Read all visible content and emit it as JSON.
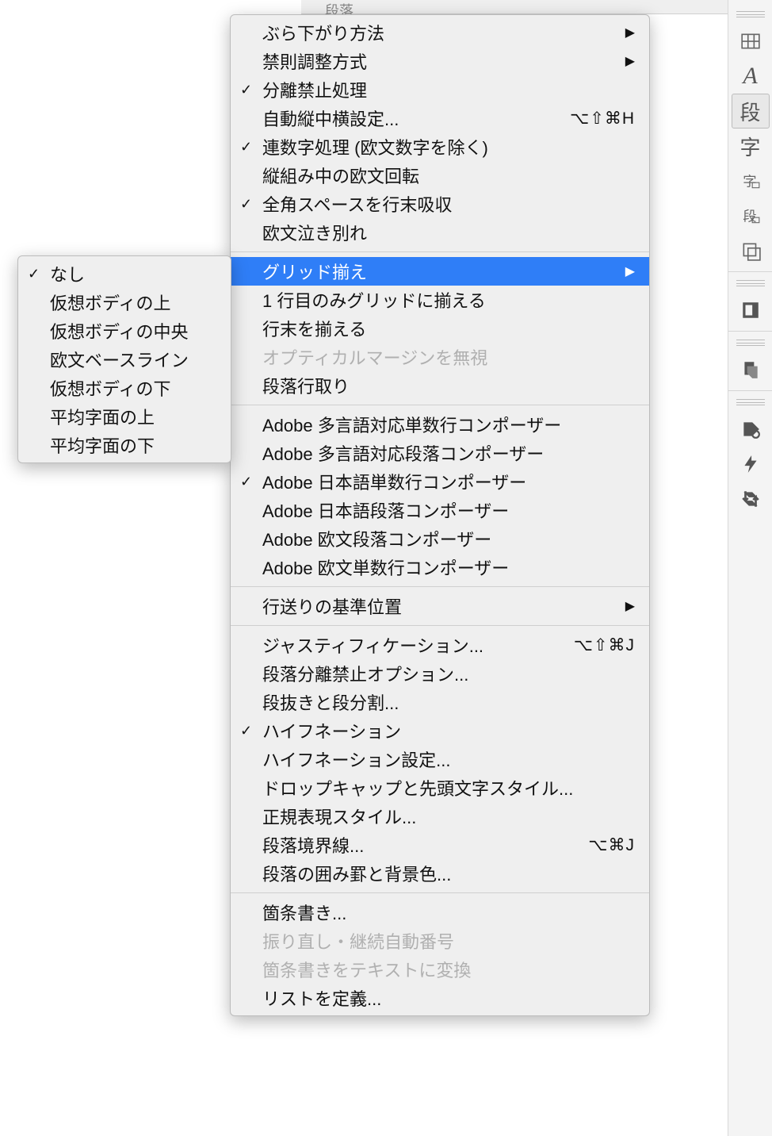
{
  "toolbar": {
    "text": "段落"
  },
  "main_menu": {
    "group1": [
      {
        "label": "ぶら下がり方法",
        "checked": false,
        "shortcut": "",
        "arrow": true,
        "disabled": false,
        "name": "hanging-method"
      },
      {
        "label": "禁則調整方式",
        "checked": false,
        "shortcut": "",
        "arrow": true,
        "disabled": false,
        "name": "kinsoku-adjust"
      },
      {
        "label": "分離禁止処理",
        "checked": true,
        "shortcut": "",
        "arrow": false,
        "disabled": false,
        "name": "no-break"
      },
      {
        "label": "自動縦中横設定...",
        "checked": false,
        "shortcut": "⌥⇧⌘H",
        "arrow": false,
        "disabled": false,
        "name": "auto-tcy"
      },
      {
        "label": "連数字処理 (欧文数字を除く)",
        "checked": true,
        "shortcut": "",
        "arrow": false,
        "disabled": false,
        "name": "number-group"
      },
      {
        "label": "縦組み中の欧文回転",
        "checked": false,
        "shortcut": "",
        "arrow": false,
        "disabled": false,
        "name": "rotate-roman"
      },
      {
        "label": "全角スペースを行末吸収",
        "checked": true,
        "shortcut": "",
        "arrow": false,
        "disabled": false,
        "name": "absorb-space"
      },
      {
        "label": "欧文泣き別れ",
        "checked": false,
        "shortcut": "",
        "arrow": false,
        "disabled": false,
        "name": "roman-break"
      }
    ],
    "group2": [
      {
        "label": "グリッド揃え",
        "checked": false,
        "shortcut": "",
        "arrow": true,
        "disabled": false,
        "highlighted": true,
        "name": "grid-align"
      },
      {
        "label": "1 行目のみグリッドに揃える",
        "checked": false,
        "shortcut": "",
        "arrow": false,
        "disabled": false,
        "name": "grid-first-line"
      },
      {
        "label": "行末を揃える",
        "checked": false,
        "shortcut": "",
        "arrow": false,
        "disabled": false,
        "name": "align-line-end"
      },
      {
        "label": "オプティカルマージンを無視",
        "checked": false,
        "shortcut": "",
        "arrow": false,
        "disabled": true,
        "name": "ignore-optical"
      },
      {
        "label": "段落行取り",
        "checked": false,
        "shortcut": "",
        "arrow": false,
        "disabled": false,
        "name": "paragraph-gyodori"
      }
    ],
    "group3": [
      {
        "label": "Adobe 多言語対応単数行コンポーザー",
        "checked": false,
        "name": "composer-world-single"
      },
      {
        "label": "Adobe 多言語対応段落コンポーザー",
        "checked": false,
        "name": "composer-world-para"
      },
      {
        "label": "Adobe 日本語単数行コンポーザー",
        "checked": true,
        "name": "composer-jp-single"
      },
      {
        "label": "Adobe 日本語段落コンポーザー",
        "checked": false,
        "name": "composer-jp-para"
      },
      {
        "label": "Adobe 欧文段落コンポーザー",
        "checked": false,
        "name": "composer-roman-para"
      },
      {
        "label": "Adobe 欧文単数行コンポーザー",
        "checked": false,
        "name": "composer-roman-single"
      }
    ],
    "group4": [
      {
        "label": "行送りの基準位置",
        "checked": false,
        "shortcut": "",
        "arrow": true,
        "disabled": false,
        "name": "leading-basis"
      }
    ],
    "group5": [
      {
        "label": "ジャスティフィケーション...",
        "checked": false,
        "shortcut": "⌥⇧⌘J",
        "arrow": false,
        "disabled": false,
        "name": "justification"
      },
      {
        "label": "段落分離禁止オプション...",
        "checked": false,
        "shortcut": "",
        "arrow": false,
        "disabled": false,
        "name": "keep-options"
      },
      {
        "label": "段抜きと段分割...",
        "checked": false,
        "shortcut": "",
        "arrow": false,
        "disabled": false,
        "name": "span-columns"
      },
      {
        "label": "ハイフネーション",
        "checked": true,
        "shortcut": "",
        "arrow": false,
        "disabled": false,
        "name": "hyphenation"
      },
      {
        "label": "ハイフネーション設定...",
        "checked": false,
        "shortcut": "",
        "arrow": false,
        "disabled": false,
        "name": "hyphenation-settings"
      },
      {
        "label": "ドロップキャップと先頭文字スタイル...",
        "checked": false,
        "shortcut": "",
        "arrow": false,
        "disabled": false,
        "name": "drop-caps"
      },
      {
        "label": "正規表現スタイル...",
        "checked": false,
        "shortcut": "",
        "arrow": false,
        "disabled": false,
        "name": "grep-styles"
      },
      {
        "label": "段落境界線...",
        "checked": false,
        "shortcut": "⌥⌘J",
        "arrow": false,
        "disabled": false,
        "name": "paragraph-rules"
      },
      {
        "label": "段落の囲み罫と背景色...",
        "checked": false,
        "shortcut": "",
        "arrow": false,
        "disabled": false,
        "name": "paragraph-border"
      }
    ],
    "group6": [
      {
        "label": "箇条書き...",
        "checked": false,
        "shortcut": "",
        "arrow": false,
        "disabled": false,
        "name": "bullets"
      },
      {
        "label": "振り直し・継続自動番号",
        "checked": false,
        "shortcut": "",
        "arrow": false,
        "disabled": true,
        "name": "restart-numbers"
      },
      {
        "label": "箇条書きをテキストに変換",
        "checked": false,
        "shortcut": "",
        "arrow": false,
        "disabled": true,
        "name": "convert-bullets"
      },
      {
        "label": "リストを定義...",
        "checked": false,
        "shortcut": "",
        "arrow": false,
        "disabled": false,
        "name": "define-lists"
      }
    ]
  },
  "sub_menu": {
    "items": [
      {
        "label": "なし",
        "checked": true,
        "name": "none"
      },
      {
        "label": "仮想ボディの上",
        "checked": false,
        "name": "embox-top"
      },
      {
        "label": "仮想ボディの中央",
        "checked": false,
        "name": "embox-center"
      },
      {
        "label": "欧文ベースライン",
        "checked": false,
        "name": "roman-baseline"
      },
      {
        "label": "仮想ボディの下",
        "checked": false,
        "name": "embox-bottom"
      },
      {
        "label": "平均字面の上",
        "checked": false,
        "name": "icf-top"
      },
      {
        "label": "平均字面の下",
        "checked": false,
        "name": "icf-bottom"
      }
    ]
  },
  "right_panel": {
    "items": [
      {
        "name": "grid-icon",
        "type": "grid"
      },
      {
        "name": "character-icon",
        "type": "A"
      },
      {
        "name": "paragraph-icon",
        "type": "段",
        "active": true
      },
      {
        "name": "glyph-icon",
        "type": "字"
      },
      {
        "name": "char-style-icon",
        "type": "字s"
      },
      {
        "name": "para-style-icon",
        "type": "段s"
      },
      {
        "name": "object-style-icon",
        "type": "obj"
      },
      {
        "name": "story-icon",
        "type": "story"
      },
      {
        "name": "script-icon",
        "type": "script"
      },
      {
        "name": "tag-icon",
        "type": "tag"
      },
      {
        "name": "bolt-icon",
        "type": "bolt"
      },
      {
        "name": "crossref-icon",
        "type": "crossref"
      }
    ]
  }
}
